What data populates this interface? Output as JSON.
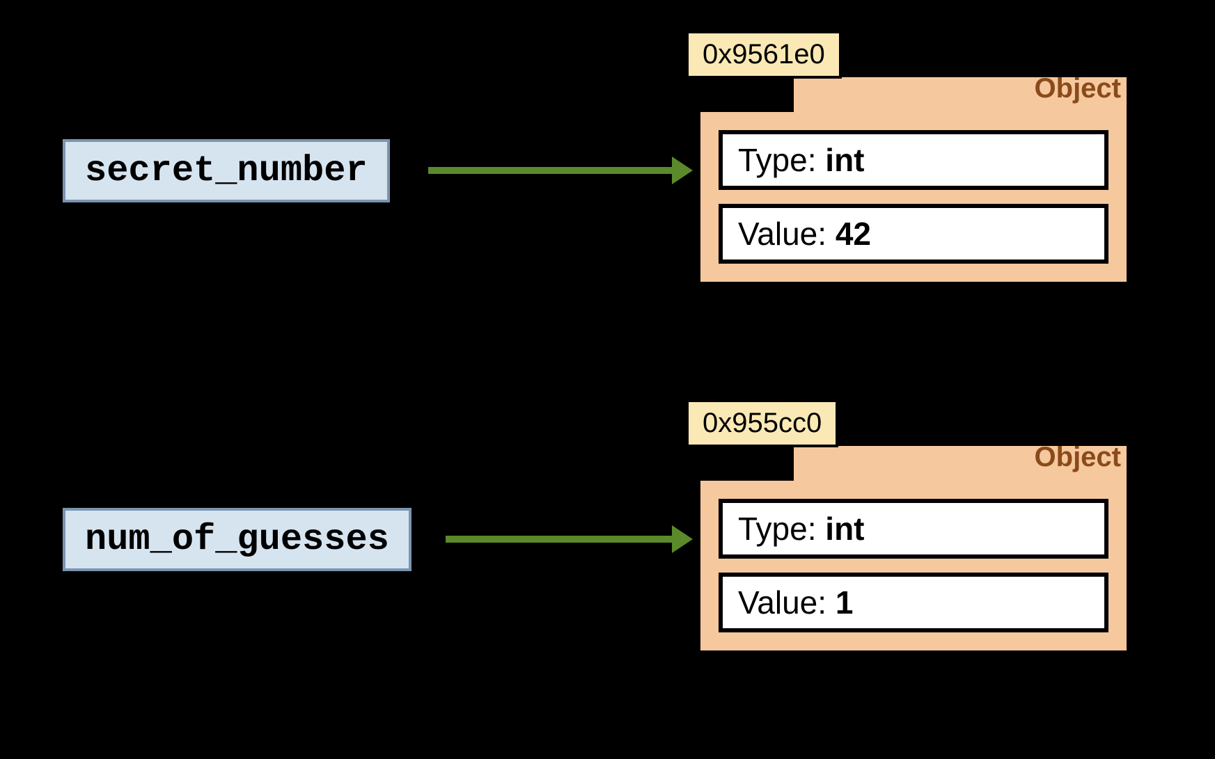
{
  "variables": [
    {
      "name": "secret_number",
      "address": "0x9561e0",
      "object_label": "Object",
      "type_label": "Type:",
      "type_value": "int",
      "value_label": "Value:",
      "value_value": "42"
    },
    {
      "name": "num_of_guesses",
      "address": "0x955cc0",
      "object_label": "Object",
      "type_label": "Type:",
      "type_value": "int",
      "value_label": "Value:",
      "value_value": "1"
    }
  ]
}
